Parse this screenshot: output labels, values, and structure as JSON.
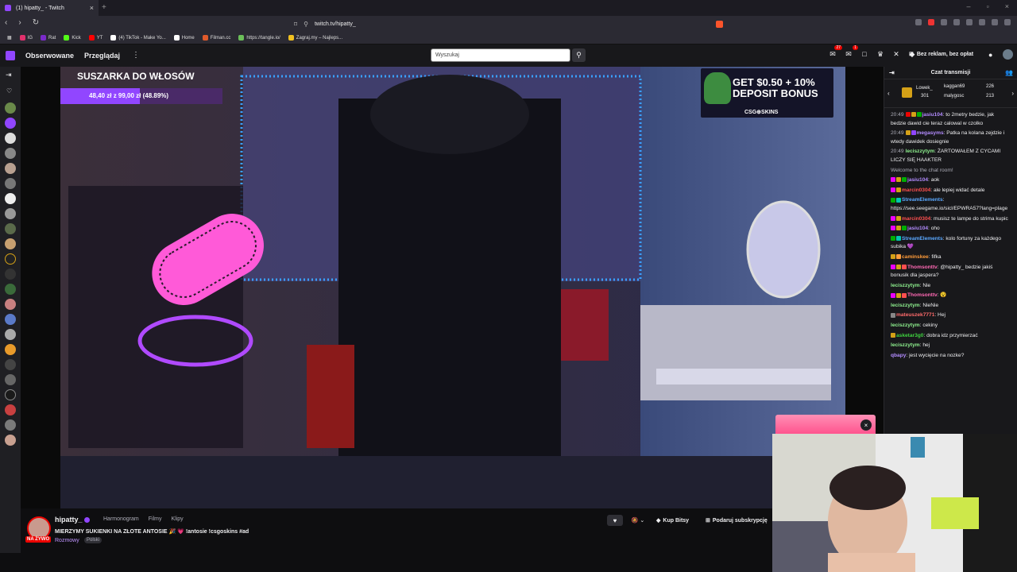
{
  "browser": {
    "tab_title": "(1) hipatty_ - Twitch",
    "new_tab": "+",
    "url": "twitch.tv/hipatty_",
    "bookmarks": [
      {
        "label": "IG",
        "color": "#e1306c"
      },
      {
        "label": "Rat",
        "color": "#7a2ac9"
      },
      {
        "label": "Kick",
        "color": "#53fc18"
      },
      {
        "label": "YT",
        "color": "#ff0000"
      },
      {
        "label": "(4) TikTok - Make Yo...",
        "color": "#ffffff"
      },
      {
        "label": "Home",
        "color": "#ffffff"
      },
      {
        "label": "Filman.cc",
        "color": "#e05a2b"
      },
      {
        "label": "https://tangle.io/",
        "color": "#6bbf59"
      },
      {
        "label": "Zagraj.my – Najleps...",
        "color": "#f0c020"
      }
    ]
  },
  "twitch_nav": {
    "following": "Obserwowane",
    "browse": "Przeglądaj",
    "more": "⋮",
    "search_placeholder": "Wyszukaj",
    "notif_count": "27",
    "whisper_count": "1",
    "ad_free": "Bez reklam, bez opłat"
  },
  "stream_overlay": {
    "goal_title": "SUSZARKA DO WŁOSÓW",
    "goal_progress": "48,40 zł z 99,00 zł (48.89%)",
    "goal_fraction": 0.4889,
    "ad_line1": "GET $0.50 + 10%",
    "ad_line2": "DEPOSIT BONUS",
    "ad_brand": "CSG⊕SKINS"
  },
  "channel": {
    "name": "hipatty_",
    "live_label": "NA ŻYWO",
    "tabs": [
      "Harmonogram",
      "Filmy",
      "Klipy"
    ],
    "title": "MIERZYMY SUKIENKI NA ZŁOTE ANTOSIE 🎉 💗 !antosie !csgoskins #ad",
    "category": "Rozmowy",
    "tag": "Polski",
    "bits_label": "Kup Bitsy",
    "gift_label": "Podaruj subskrypcję"
  },
  "chat": {
    "header": "Czat transmisji",
    "leaderboard": {
      "first_user": "Lowek_",
      "first_value": "301",
      "rank2_user": "kaggan69",
      "rank2_value": "226",
      "rank3_user": "malygosc",
      "rank3_value": "213"
    },
    "messages": [
      {
        "time": "20:49",
        "user": "jasiu104",
        "color": "#b38cff",
        "text": ": to 2metry bedzie, jak bedzie dawid cie teraz calowal w czolko",
        "badges": [
          "#eb0400",
          "#d4a017",
          "#00ad03"
        ]
      },
      {
        "time": "20:49",
        "user": "megasyms",
        "color": "#b38cff",
        "text": ": Patka na kolana zejdzie i wtedy dawidek dosiegnie",
        "badges": [
          "#d4a017",
          "#9146ff"
        ]
      },
      {
        "time": "20:49",
        "user": "leciszzytym",
        "color": "#8ef08e",
        "text": ": ŻARTOWAŁEM Z CYCAMI LICZY SIĘ HAAKTER",
        "badges": []
      },
      {
        "time": "",
        "user": "",
        "color": "#adadb8",
        "text": "Welcome to the chat room!",
        "badges": [],
        "system": true
      },
      {
        "time": "",
        "user": "jasiu104",
        "color": "#b38cff",
        "text": ": aok",
        "badges": [
          "#eb00ff",
          "#d4a017",
          "#00ad03"
        ]
      },
      {
        "time": "",
        "user": "marcin0304",
        "color": "#ff4f4f",
        "text": ": ale lepiej widać detale",
        "badges": [
          "#eb00ff",
          "#d4a017"
        ]
      },
      {
        "time": "",
        "user": "StreamElements",
        "color": "#5aa8ff",
        "text": ": https://see.seegame.io/sicl/EPWRA57?lang=plage",
        "badges": [
          "#00ad03",
          "#00c8af"
        ]
      },
      {
        "time": "",
        "user": "marcin0304",
        "color": "#ff4f4f",
        "text": ": musisz te lampe do strima kupic",
        "badges": [
          "#eb00ff",
          "#d4a017"
        ]
      },
      {
        "time": "",
        "user": "jasiu104",
        "color": "#b38cff",
        "text": ": oho",
        "badges": [
          "#eb00ff",
          "#d4a017",
          "#00ad03"
        ]
      },
      {
        "time": "",
        "user": "StreamElements",
        "color": "#5aa8ff",
        "text": ": kolo fortuny za każdego subika 💜",
        "badges": [
          "#00ad03",
          "#00c8af"
        ]
      },
      {
        "time": "",
        "user": "caminskee",
        "color": "#ff9c3a",
        "text": ": fifka",
        "badges": [
          "#d4a017",
          "#ff9c3a"
        ]
      },
      {
        "time": "",
        "user": "Thomsonttv",
        "color": "#ff69b4",
        "text": ": @hipatty_ bedzie jakiś bonusik dla jaspera?",
        "badges": [
          "#eb00ff",
          "#d4a017",
          "#ff4f4f"
        ]
      },
      {
        "time": "",
        "user": "leciszzytym",
        "color": "#8ef08e",
        "text": ": Nie",
        "badges": []
      },
      {
        "time": "",
        "user": "Thomsonttv",
        "color": "#ff69b4",
        "text": ": 😵",
        "badges": [
          "#eb00ff",
          "#d4a017",
          "#ff4f4f"
        ]
      },
      {
        "time": "",
        "user": "leciszzytym",
        "color": "#8ef08e",
        "text": ": NieNie",
        "badges": []
      },
      {
        "time": "",
        "user": "mateuszek7771",
        "color": "#ff6b6b",
        "text": ": Hej",
        "badges": [
          "#888888"
        ]
      },
      {
        "time": "",
        "user": "leciszzytym",
        "color": "#8ef08e",
        "text": ": cekiny",
        "badges": []
      },
      {
        "time": "",
        "user": "asketar3g0",
        "color": "#3fd23f",
        "text": ": dobra idz przymierzać",
        "badges": [
          "#d4a017"
        ]
      },
      {
        "time": "",
        "user": "leciszzytym",
        "color": "#8ef08e",
        "text": ": hej",
        "badges": []
      },
      {
        "time": "",
        "user": "qbapy",
        "color": "#b38cff",
        "text": ": jest wycięcie na nozke?",
        "badges": []
      }
    ]
  },
  "colors": {
    "twitch_purple": "#9146ff",
    "live_red": "#eb0400",
    "chat_bg": "#18181b"
  },
  "icons": {
    "sidebar_collapse": "arrow-right-icon",
    "heart": "heart-icon",
    "search": "search-icon",
    "close": "close-icon"
  }
}
